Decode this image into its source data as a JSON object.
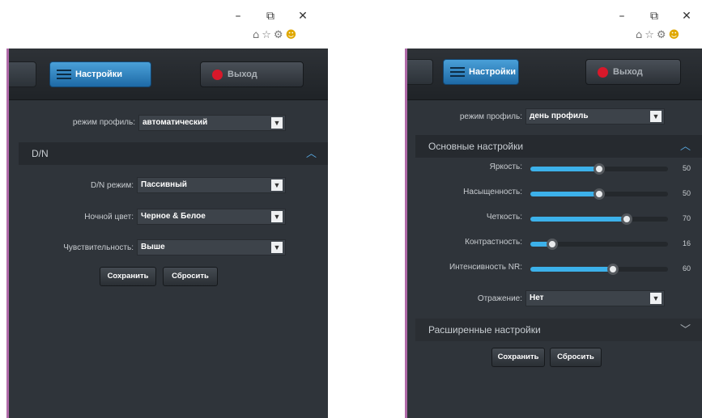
{
  "left_window": {
    "controls": {
      "minimize": "–",
      "restore": "⧉",
      "close": "✕"
    },
    "browser_icons": {
      "home": "⌂",
      "star": "☆",
      "gear": "⚙",
      "smile": "☻"
    },
    "toolbar": {
      "settings_label": "Настройки",
      "exit_label": "Выход"
    },
    "profile": {
      "label": "режим профиль:",
      "value": "автоматический"
    },
    "section": {
      "title": "D/N",
      "state": "expanded"
    },
    "fields": [
      {
        "label": "D/N режим:",
        "value": "Пассивный"
      },
      {
        "label": "Ночной цвет:",
        "value": "Черное & Белое"
      },
      {
        "label": "Чувствительность:",
        "value": "Выше"
      }
    ],
    "buttons": {
      "save": "Сохранить",
      "reset": "Сбросить"
    }
  },
  "right_window": {
    "controls": {
      "minimize": "–",
      "restore": "⧉",
      "close": "✕"
    },
    "browser_icons": {
      "home": "⌂",
      "star": "☆",
      "gear": "⚙",
      "smile": "☻"
    },
    "toolbar": {
      "settings_label": "Настройки",
      "exit_label": "Выход"
    },
    "profile": {
      "label": "режим профиль:",
      "value": "день профиль"
    },
    "basic_section": {
      "title": "Основные настройки",
      "state": "expanded"
    },
    "sliders": [
      {
        "label": "Яркость:",
        "value": 50,
        "display": "50"
      },
      {
        "label": "Насыщенность:",
        "value": 50,
        "display": "50"
      },
      {
        "label": "Четкость:",
        "value": 70,
        "display": "70"
      },
      {
        "label": "Контрастность:",
        "value": 16,
        "display": "16"
      },
      {
        "label": "Интенсивность NR:",
        "value": 60,
        "display": "60"
      }
    ],
    "mirror": {
      "label": "Отражение:",
      "value": "Нет"
    },
    "advanced_section": {
      "title": "Расширенные настройки",
      "state": "collapsed"
    },
    "buttons": {
      "save": "Сохранить",
      "reset": "Сбросить"
    }
  },
  "colors": {
    "accent": "#3cb1ea",
    "panel": "#2f343a",
    "exit_dot": "#d8182a",
    "window_border": "#b06aa8"
  }
}
